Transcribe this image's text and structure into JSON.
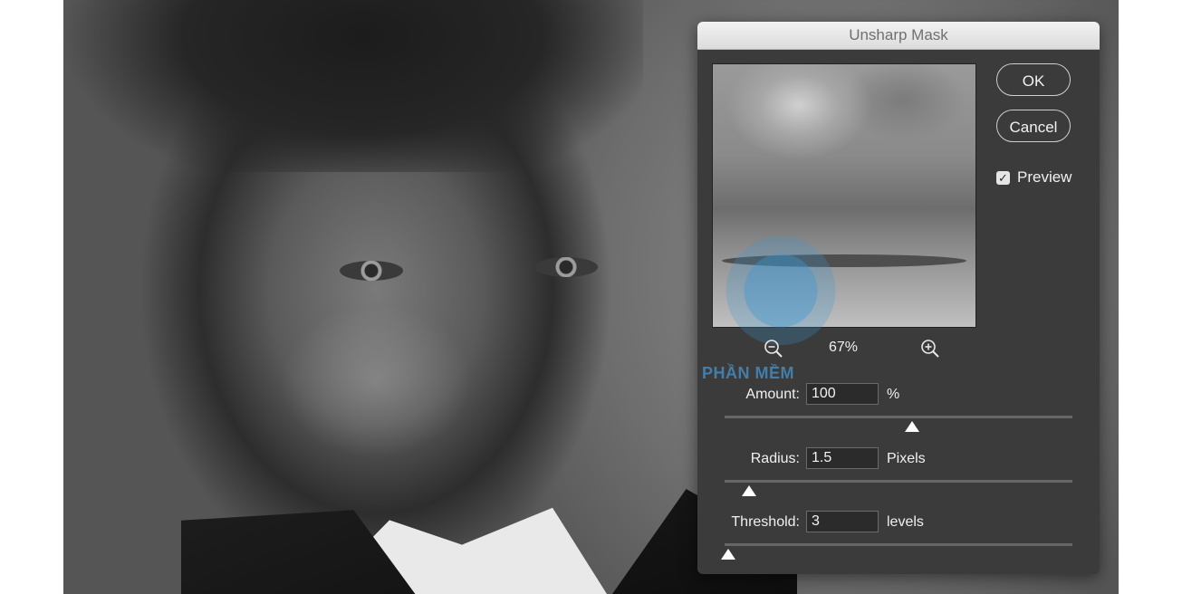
{
  "dialog": {
    "title": "Unsharp Mask",
    "ok_label": "OK",
    "cancel_label": "Cancel",
    "preview_label": "Preview",
    "preview_checked": true,
    "zoom_level": "67%"
  },
  "watermark": {
    "text": "PHẦN MỀM"
  },
  "params": {
    "amount": {
      "label": "Amount:",
      "value": "100",
      "unit": "%",
      "slider_fraction": 0.54
    },
    "radius": {
      "label": "Radius:",
      "value": "1.5",
      "unit": "Pixels",
      "slider_fraction": 0.07
    },
    "threshold": {
      "label": "Threshold:",
      "value": "3",
      "unit": "levels",
      "slider_fraction": 0.01
    }
  },
  "icons": {
    "zoom_out": "zoom-out-icon",
    "zoom_in": "zoom-in-icon",
    "check": "check-icon"
  },
  "colors": {
    "dialog_bg": "#3b3b3b",
    "titlebar_bg": "#e4e4e4",
    "watermark": "#3c96d2"
  }
}
